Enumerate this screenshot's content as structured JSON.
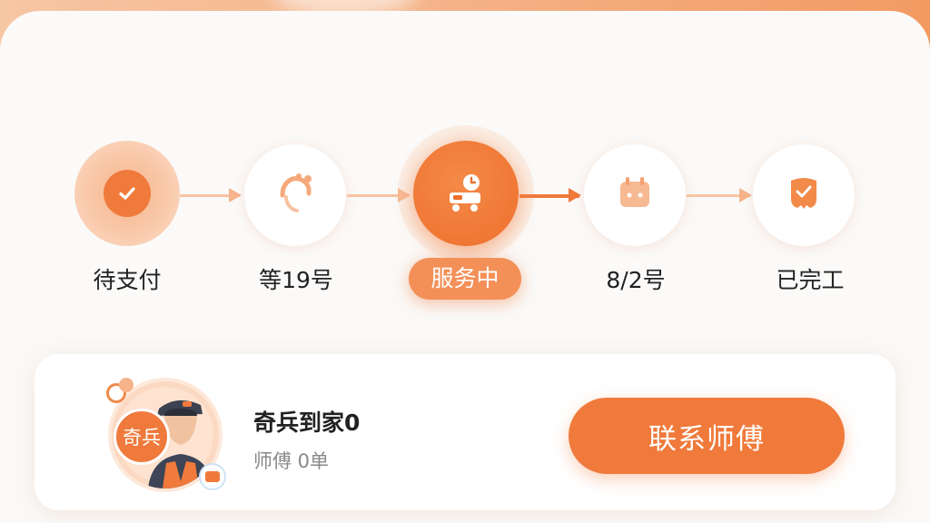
{
  "steps": [
    {
      "label": "待支付",
      "icon": "check-icon",
      "state": "done"
    },
    {
      "label": "等19号",
      "icon": "headset-icon",
      "state": "pending"
    },
    {
      "label": "服务中",
      "icon": "service-cart-icon",
      "state": "active"
    },
    {
      "label": "8/2号",
      "icon": "calendar-icon",
      "state": "pending"
    },
    {
      "label": "已完工",
      "icon": "shield-check-icon",
      "state": "pending"
    }
  ],
  "technician": {
    "badge": "奇兵",
    "name": "奇兵到家0",
    "meta": "师傅 0单"
  },
  "actions": {
    "contact_label": "联系师傅"
  },
  "colors": {
    "accent": "#ef7a3c",
    "accent_light": "#f8c4a2",
    "background": "#fbfaf9"
  }
}
